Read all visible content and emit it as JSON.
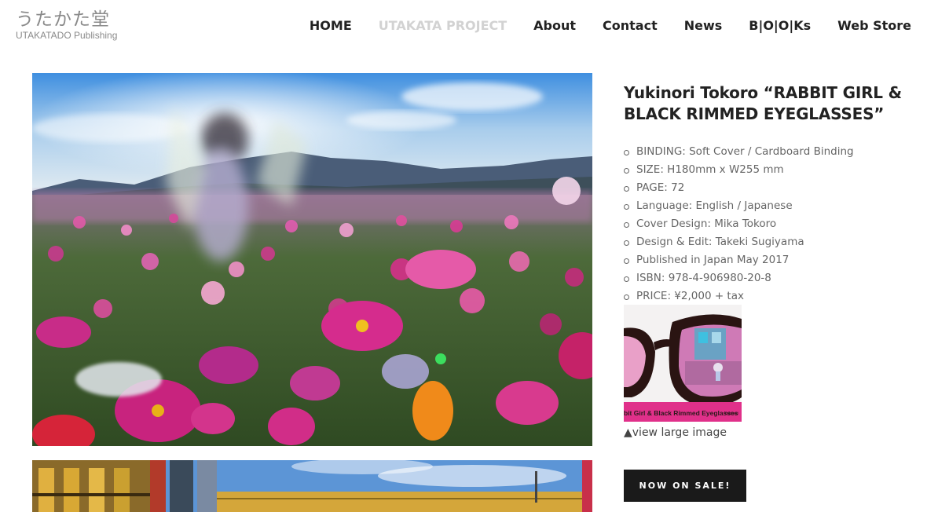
{
  "logo": {
    "jp": "うたかた堂",
    "en": "UTAKATADO Publishing"
  },
  "nav": [
    {
      "label": "HOME"
    },
    {
      "label": "UTAKATA PROJECT",
      "active": true
    },
    {
      "label": "About"
    },
    {
      "label": "Contact"
    },
    {
      "label": "News"
    },
    {
      "label": "B|O|O|Ks"
    },
    {
      "label": "Web Store"
    }
  ],
  "book": {
    "title": "Yukinori Tokoro “RABBIT GIRL & BLACK RIMMED EYEGLASSES”",
    "specs": [
      "BINDING: Soft Cover / Cardboard Binding",
      "SIZE: H180mm x W255 mm",
      "PAGE: 72",
      "Language: English / Japanese",
      "Cover Design: Mika Tokoro",
      "Design & Edit: Takeki Sugiyama",
      "Published in Japan May 2017",
      "ISBN: 978-4-906980-20-8",
      "PRICE: ¥2,000 + tax"
    ],
    "cover_caption": "bit Girl & Black Rimmed Eyeglasses",
    "cover_caption_small": "Yukinori",
    "view_large": "▲view large image",
    "sale_button": "NOW ON SALE!"
  },
  "colors": {
    "nav_active": "#d2d2d2",
    "button_bg": "#1a1a1a",
    "cover_band": "#e0308a"
  }
}
